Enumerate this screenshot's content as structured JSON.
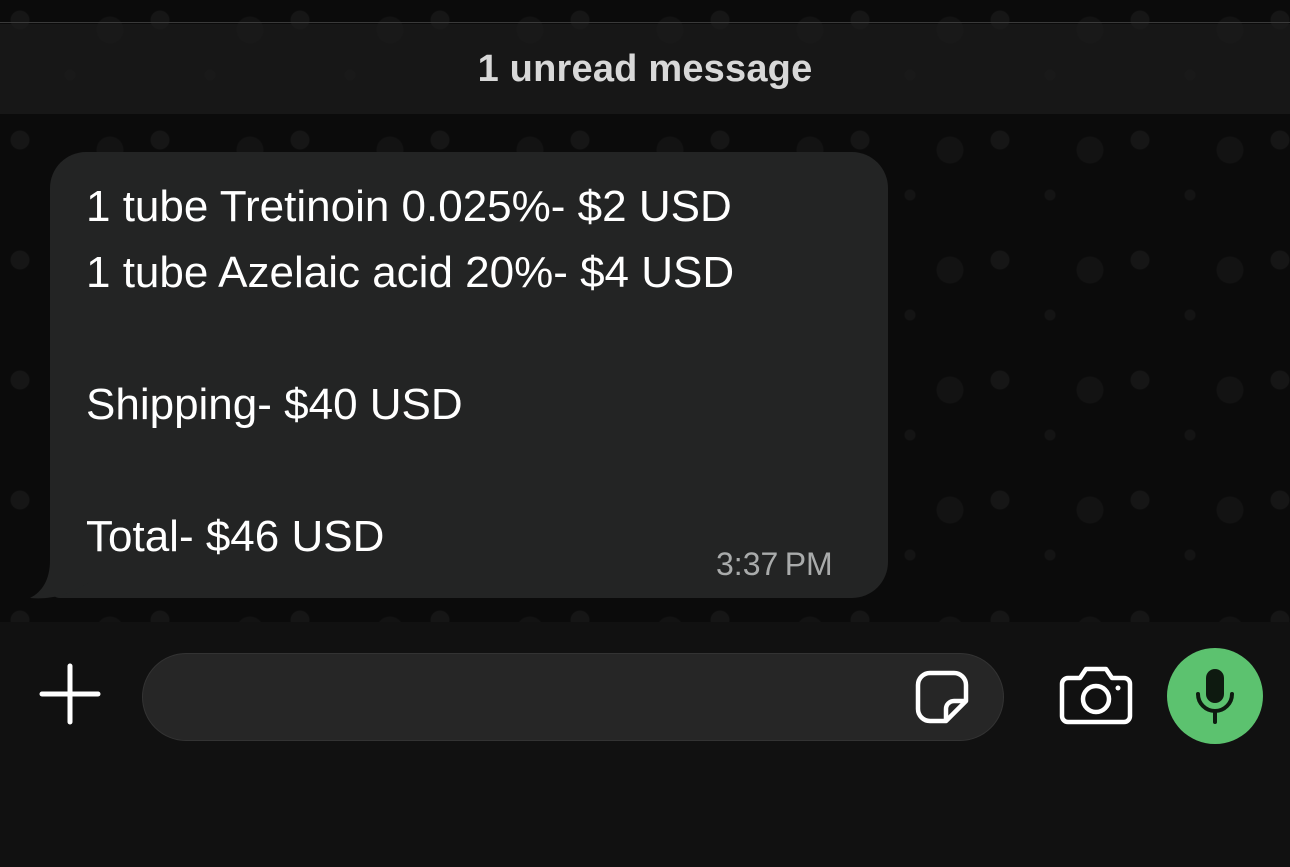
{
  "chat": {
    "unread_banner": "1 unread message",
    "message": {
      "lines": [
        "1 tube Tretinoin 0.025%- $2 USD",
        "1 tube Azelaic acid 20%- $4 USD",
        "Shipping- $40 USD",
        "Total- $46 USD"
      ],
      "timestamp": "3:37 PM"
    }
  },
  "composer": {
    "input_value": "",
    "icons": {
      "add": "plus-icon",
      "sticker": "sticker-icon",
      "camera": "camera-icon",
      "mic": "microphone-icon"
    }
  },
  "colors": {
    "background": "#0b0b0b",
    "bubble": "#232424",
    "mic_accent": "#5cc26f",
    "timestamp": "#a9abab"
  }
}
